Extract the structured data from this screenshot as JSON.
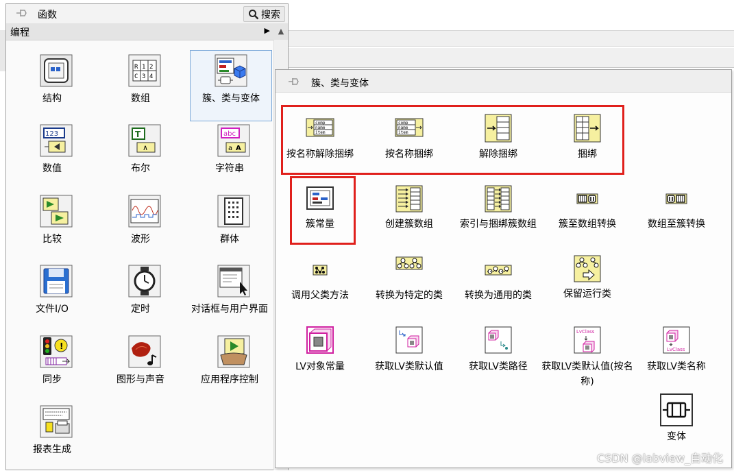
{
  "palette": {
    "title": "函数",
    "search_label": "搜索",
    "category": "编程",
    "items": [
      {
        "label": "结构",
        "icon": "structures-icon"
      },
      {
        "label": "数组",
        "icon": "array-icon"
      },
      {
        "label": "簇、类与变体",
        "icon": "cluster-class-variant-icon"
      },
      {
        "label": "数值",
        "icon": "numeric-icon"
      },
      {
        "label": "布尔",
        "icon": "boolean-icon"
      },
      {
        "label": "字符串",
        "icon": "string-icon"
      },
      {
        "label": "比较",
        "icon": "comparison-icon"
      },
      {
        "label": "波形",
        "icon": "waveform-icon"
      },
      {
        "label": "群体",
        "icon": "group-icon"
      },
      {
        "label": "文件I/O",
        "icon": "file-io-icon"
      },
      {
        "label": "定时",
        "icon": "timing-icon"
      },
      {
        "label": "对话框与用户界面",
        "icon": "dialog-ui-icon"
      },
      {
        "label": "同步",
        "icon": "synchronization-icon"
      },
      {
        "label": "图形与声音",
        "icon": "graphics-sound-icon"
      },
      {
        "label": "应用程序控制",
        "icon": "app-control-icon"
      },
      {
        "label": "报表生成",
        "icon": "report-generation-icon"
      }
    ]
  },
  "submenu": {
    "title": "簇、类与变体",
    "items": [
      {
        "label": "按名称解除捆绑",
        "icon": "unbundle-by-name-icon"
      },
      {
        "label": "按名称捆绑",
        "icon": "bundle-by-name-icon"
      },
      {
        "label": "解除捆绑",
        "icon": "unbundle-icon"
      },
      {
        "label": "捆绑",
        "icon": "bundle-icon"
      },
      {
        "label": "簇常量",
        "icon": "cluster-constant-icon"
      },
      {
        "label": "创建簇数组",
        "icon": "build-cluster-array-icon"
      },
      {
        "label": "索引与捆绑簇数组",
        "icon": "index-bundle-cluster-array-icon"
      },
      {
        "label": "簇至数组转换",
        "icon": "cluster-to-array-icon"
      },
      {
        "label": "数组至簇转换",
        "icon": "array-to-cluster-icon"
      },
      {
        "label": "调用父类方法",
        "icon": "call-parent-method-icon"
      },
      {
        "label": "转换为特定的类",
        "icon": "to-more-specific-class-icon"
      },
      {
        "label": "转换为通用的类",
        "icon": "to-more-generic-class-icon"
      },
      {
        "label": "保留运行类",
        "icon": "preserve-runtime-class-icon"
      },
      {
        "label": "LV对象常量",
        "icon": "lv-object-constant-icon"
      },
      {
        "label": "获取LV类默认值",
        "icon": "get-lv-class-default-value-icon"
      },
      {
        "label": "获取LV类路径",
        "icon": "get-lv-class-path-icon"
      },
      {
        "label": "获取LV类默认值(按名称)",
        "icon": "get-lv-class-default-value-by-name-icon"
      },
      {
        "label": "获取LV类名称",
        "icon": "get-lv-class-name-icon"
      },
      {
        "label": "变体",
        "icon": "variant-icon"
      }
    ]
  },
  "watermark": "CSDN @labview_自动化",
  "colors": {
    "highlight_box": "#e0201c",
    "selection": "#7aa7d8"
  }
}
